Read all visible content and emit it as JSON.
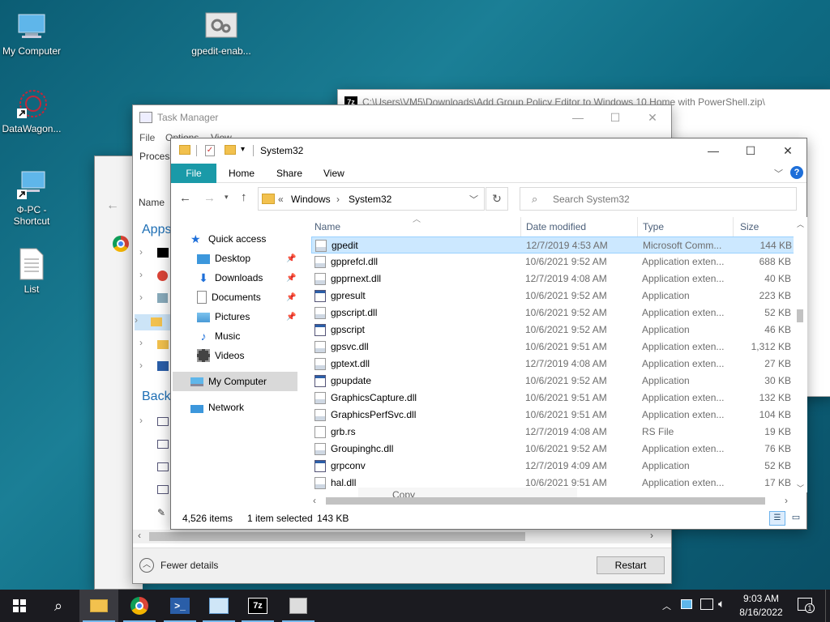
{
  "desktop": {
    "icons": [
      {
        "label": "My Computer"
      },
      {
        "label": "gpedit-enab..."
      },
      {
        "label": "DataWagon..."
      },
      {
        "label": "Ф-PC -\nShortcut"
      },
      {
        "label": "List"
      }
    ]
  },
  "zip_window": {
    "title": "C:\\Users\\VM5\\Downloads\\Add Group Policy Editor to Windows 10 Home with PowerShell.zip\\"
  },
  "task_manager": {
    "title": "Task Manager",
    "menu": [
      "File",
      "Options",
      "View"
    ],
    "tab_visible": "Process",
    "col_name": "Name",
    "section_apps": "Apps",
    "section_background": "Backg",
    "fewer_details": "Fewer details",
    "restart": "Restart"
  },
  "explorer": {
    "title": "System32",
    "ribbon_tabs": [
      "File",
      "Home",
      "Share",
      "View"
    ],
    "address": {
      "chevron": "«",
      "parts": [
        "Windows",
        "System32"
      ]
    },
    "search_placeholder": "Search System32",
    "nav": [
      {
        "label": "Quick access",
        "icon": "star-icon"
      },
      {
        "label": "Desktop",
        "icon": "desktop-folder-icon",
        "pinned": true
      },
      {
        "label": "Downloads",
        "icon": "downloads-icon",
        "pinned": true
      },
      {
        "label": "Documents",
        "icon": "documents-icon",
        "pinned": true
      },
      {
        "label": "Pictures",
        "icon": "pictures-icon",
        "pinned": true
      },
      {
        "label": "Music",
        "icon": "music-icon"
      },
      {
        "label": "Videos",
        "icon": "videos-icon"
      },
      {
        "label": "My Computer",
        "icon": "computer-icon",
        "selected": true
      },
      {
        "label": "Network",
        "icon": "network-icon"
      }
    ],
    "columns": [
      "Name",
      "Date modified",
      "Type",
      "Size"
    ],
    "files": [
      {
        "name": "gpedit",
        "date": "12/7/2019 4:53 AM",
        "type": "Microsoft Comm...",
        "size": "144 KB",
        "selected": true
      },
      {
        "name": "gpprefcl.dll",
        "date": "10/6/2021 9:52 AM",
        "type": "Application exten...",
        "size": "688 KB"
      },
      {
        "name": "gpprnext.dll",
        "date": "12/7/2019 4:08 AM",
        "type": "Application exten...",
        "size": "40 KB"
      },
      {
        "name": "gpresult",
        "date": "10/6/2021 9:52 AM",
        "type": "Application",
        "size": "223 KB"
      },
      {
        "name": "gpscript.dll",
        "date": "10/6/2021 9:52 AM",
        "type": "Application exten...",
        "size": "52 KB"
      },
      {
        "name": "gpscript",
        "date": "10/6/2021 9:52 AM",
        "type": "Application",
        "size": "46 KB"
      },
      {
        "name": "gpsvc.dll",
        "date": "10/6/2021 9:51 AM",
        "type": "Application exten...",
        "size": "1,312 KB"
      },
      {
        "name": "gptext.dll",
        "date": "12/7/2019 4:08 AM",
        "type": "Application exten...",
        "size": "27 KB"
      },
      {
        "name": "gpupdate",
        "date": "10/6/2021 9:52 AM",
        "type": "Application",
        "size": "30 KB"
      },
      {
        "name": "GraphicsCapture.dll",
        "date": "10/6/2021 9:51 AM",
        "type": "Application exten...",
        "size": "132 KB"
      },
      {
        "name": "GraphicsPerfSvc.dll",
        "date": "10/6/2021 9:51 AM",
        "type": "Application exten...",
        "size": "104 KB"
      },
      {
        "name": "grb.rs",
        "date": "12/7/2019 4:08 AM",
        "type": "RS File",
        "size": "19 KB"
      },
      {
        "name": "Groupinghc.dll",
        "date": "10/6/2021 9:52 AM",
        "type": "Application exten...",
        "size": "76 KB"
      },
      {
        "name": "grpconv",
        "date": "12/7/2019 4:09 AM",
        "type": "Application",
        "size": "52 KB"
      },
      {
        "name": "hal.dll",
        "date": "10/6/2021 9:51 AM",
        "type": "Application exten...",
        "size": "17 KB"
      }
    ],
    "drag_tooltip": "Copy",
    "status": {
      "items": "4,526 items",
      "selected": "1 item selected",
      "size": "143 KB"
    }
  },
  "taskbar": {
    "time": "9:03 AM",
    "date": "8/16/2022",
    "notification_count": "1"
  }
}
